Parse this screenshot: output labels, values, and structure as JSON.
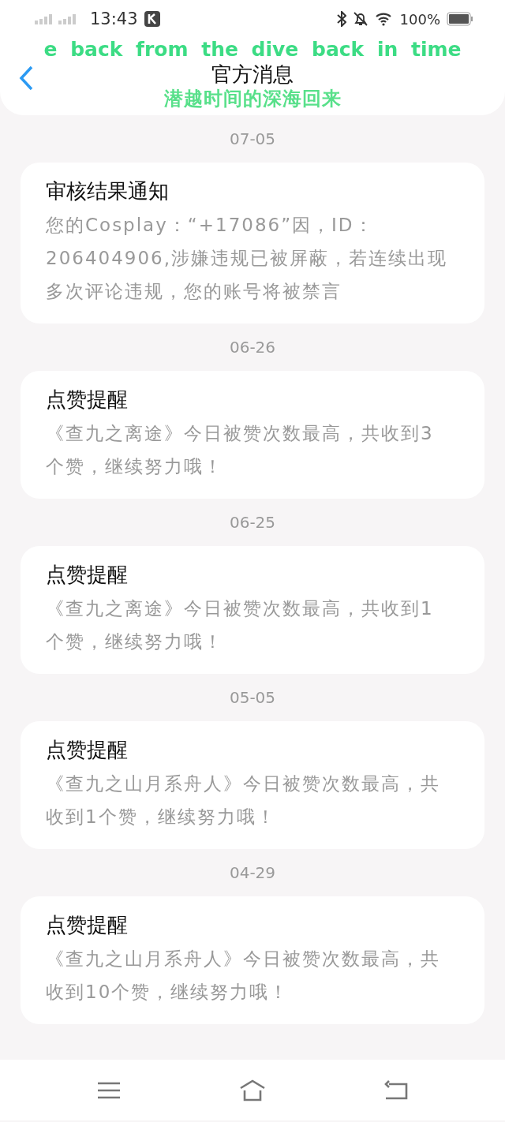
{
  "status_bar": {
    "time": "13:43",
    "battery": "100%"
  },
  "header": {
    "title": "官方消息"
  },
  "lyrics_overlay": {
    "line_1": "e back from the dive back in time",
    "line_2": "潜越时间的深海回来"
  },
  "messages": [
    {
      "date": "07-05",
      "title": "审核结果通知",
      "body": "您的Cosplay：“+17086”因，ID：206404906,涉嫌违规已被屏蔽，若连续出现多次评论违规，您的账号将被禁言"
    },
    {
      "date": "06-26",
      "title": "点赞提醒",
      "body": "《查九之离途》今日被赞次数最高，共收到3个赞，继续努力哦！"
    },
    {
      "date": "06-25",
      "title": "点赞提醒",
      "body": "《查九之离途》今日被赞次数最高，共收到1个赞，继续努力哦！"
    },
    {
      "date": "05-05",
      "title": "点赞提醒",
      "body": "《查九之山月系舟人》今日被赞次数最高，共收到1个赞，继续努力哦！"
    },
    {
      "date": "04-29",
      "title": "点赞提醒",
      "body": "《查九之山月系舟人》今日被赞次数最高，共收到10个赞，继续努力哦！"
    }
  ]
}
